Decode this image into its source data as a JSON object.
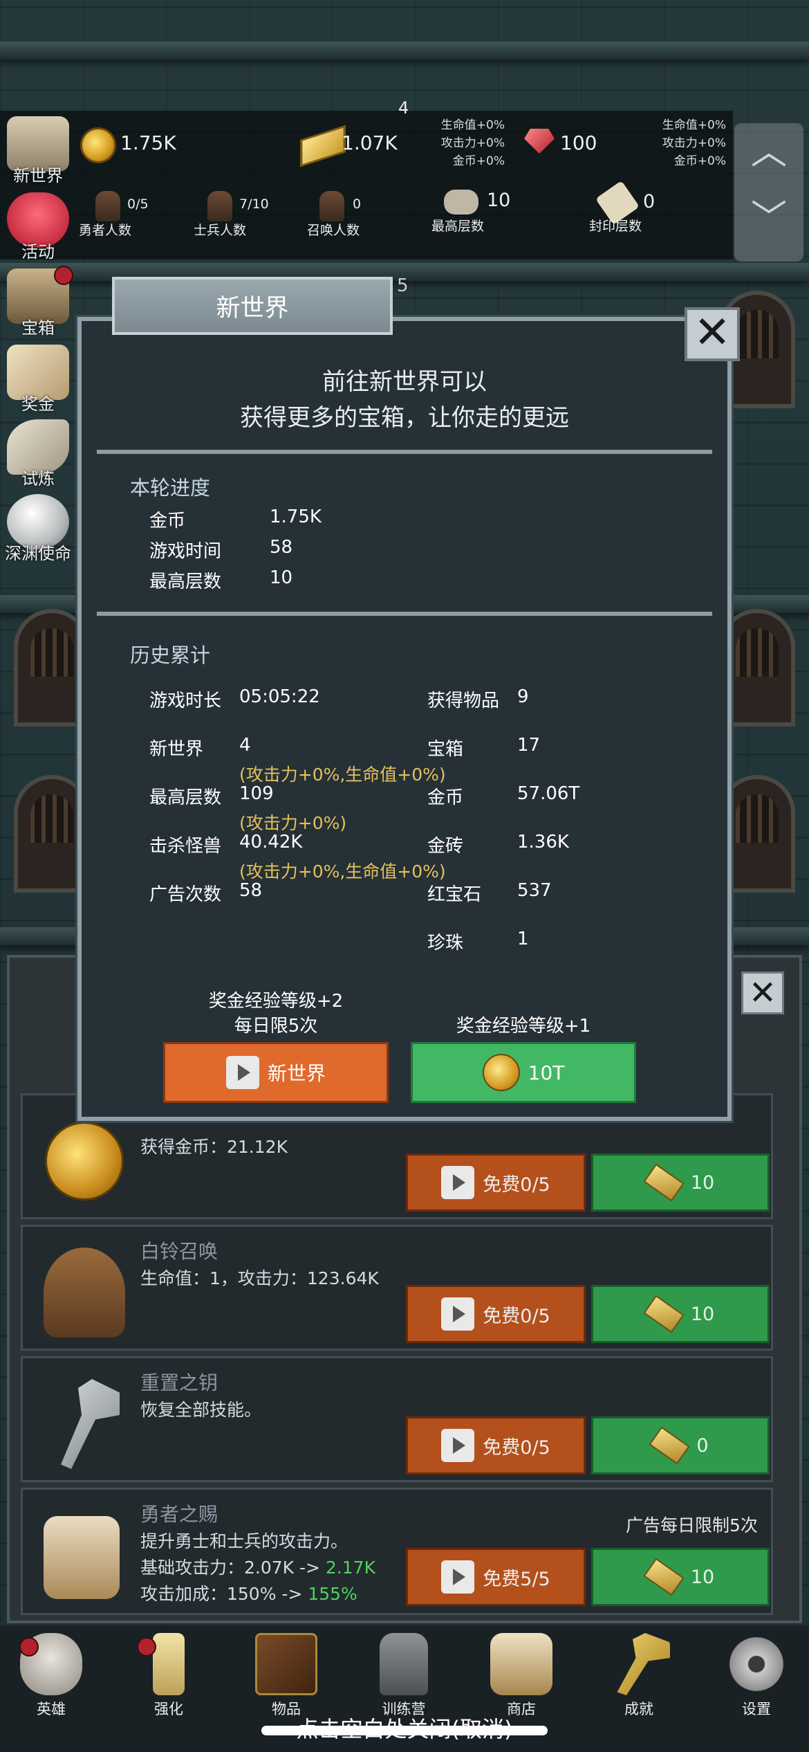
{
  "hud": {
    "level_marker": "4",
    "coins": "1.75K",
    "gold": "1.07K",
    "gold_bonus": [
      "生命值+0%",
      "攻击力+0%",
      "金币+0%"
    ],
    "ruby": "100",
    "ruby_bonus": [
      "生命值+0%",
      "攻击力+0%",
      "金币+0%"
    ],
    "stats": [
      {
        "value": "0/5",
        "label": "勇者人数"
      },
      {
        "value": "7/10",
        "label": "士兵人数"
      },
      {
        "value": "0",
        "label": "召唤人数"
      },
      {
        "value": "10",
        "label": "最高层数"
      },
      {
        "value": "0",
        "label": "封印层数"
      }
    ],
    "floor_marker": "5"
  },
  "side_menu": [
    "新世界",
    "活动",
    "宝箱",
    "奖金",
    "试炼",
    "深渊使命"
  ],
  "dialog": {
    "title": "新世界",
    "subtitle_line1": "前往新世界可以",
    "subtitle_line2": "获得更多的宝箱，让你走的更远",
    "current_header": "本轮进度",
    "current": [
      {
        "label": "金币",
        "value": "1.75K"
      },
      {
        "label": "游戏时间",
        "value": "58"
      },
      {
        "label": "最高层数",
        "value": "10"
      }
    ],
    "history_header": "历史累计",
    "history_left": [
      {
        "label": "游戏时长",
        "value": "05:05:22"
      },
      {
        "label": "新世界",
        "value": "4",
        "note": "(攻击力+0%,生命值+0%)"
      },
      {
        "label": "最高层数",
        "value": "109",
        "note": "(攻击力+0%)"
      },
      {
        "label": "击杀怪兽",
        "value": "40.42K",
        "note": "(攻击力+0%,生命值+0%)"
      },
      {
        "label": "广告次数",
        "value": "58"
      }
    ],
    "history_right": [
      {
        "label": "获得物品",
        "value": "9"
      },
      {
        "label": "宝箱",
        "value": "17"
      },
      {
        "label": "金币",
        "value": "57.06T"
      },
      {
        "label": "金砖",
        "value": "1.36K"
      },
      {
        "label": "红宝石",
        "value": "537"
      },
      {
        "label": "珍珠",
        "value": "1"
      }
    ],
    "left_reward_line1": "奖金经验等级+2",
    "left_reward_line2": "每日限5次",
    "right_reward": "奖金经验等级+1",
    "new_world_button": "新世界",
    "cost_button": "10T"
  },
  "shop": {
    "items": [
      {
        "title": "",
        "desc": [
          "获得金币：21.12K"
        ],
        "ad_label": "免费0/5",
        "gold_label": "10"
      },
      {
        "title": "白铃召唤",
        "desc": [
          "生命值：1，攻击力：123.64K"
        ],
        "ad_label": "免费0/5",
        "gold_label": "10"
      },
      {
        "title": "重置之钥",
        "desc": [
          "恢复全部技能。"
        ],
        "ad_label": "免费0/5",
        "gold_label": "0"
      },
      {
        "title": "勇者之赐",
        "desc": [
          "提升勇士和士兵的攻击力。"
        ],
        "base_atk_prefix": "基础攻击力：2.07K -> ",
        "base_atk_new": "2.17K",
        "atk_bonus_prefix": "攻击加成：150% -> ",
        "atk_bonus_new": "155%",
        "ad_label": "免费5/5",
        "gold_label": "10",
        "limit_note": "广告每日限制5次"
      }
    ]
  },
  "nav": [
    "英雄",
    "强化",
    "物品",
    "训练营",
    "商店",
    "成就",
    "设置"
  ],
  "tap_to_close": "点击空白处关闭(取消)"
}
